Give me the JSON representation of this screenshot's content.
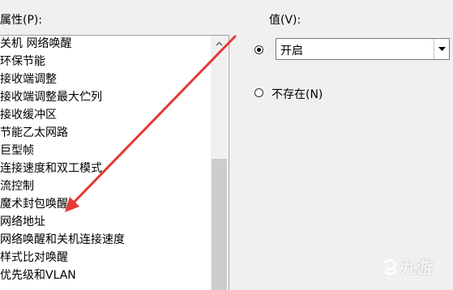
{
  "properties": {
    "label": "属性(P):",
    "items": [
      "关机 网络唤醒",
      "环保节能",
      "接收端调整",
      "接收端调整最大伫列",
      "接收缓冲区",
      "节能乙太网路",
      "巨型帧",
      "连接速度和双工模式",
      "流控制",
      "魔术封包唤醒",
      "网络地址",
      "网络唤醒和关机连接速度",
      "样式比对唤醒",
      "优先级和VLAN"
    ]
  },
  "value": {
    "label": "值(V):",
    "combo_value": "开启",
    "not_exist_label": "不存在(N)",
    "selected_option": "value"
  },
  "annotation": {
    "arrow_color": "#e53935"
  },
  "watermark": {
    "text": "九游"
  },
  "colors": {
    "window_bg": "#f0f0f0",
    "list_bg": "#ffffff",
    "scroll_thumb": "#cdcdcd"
  }
}
